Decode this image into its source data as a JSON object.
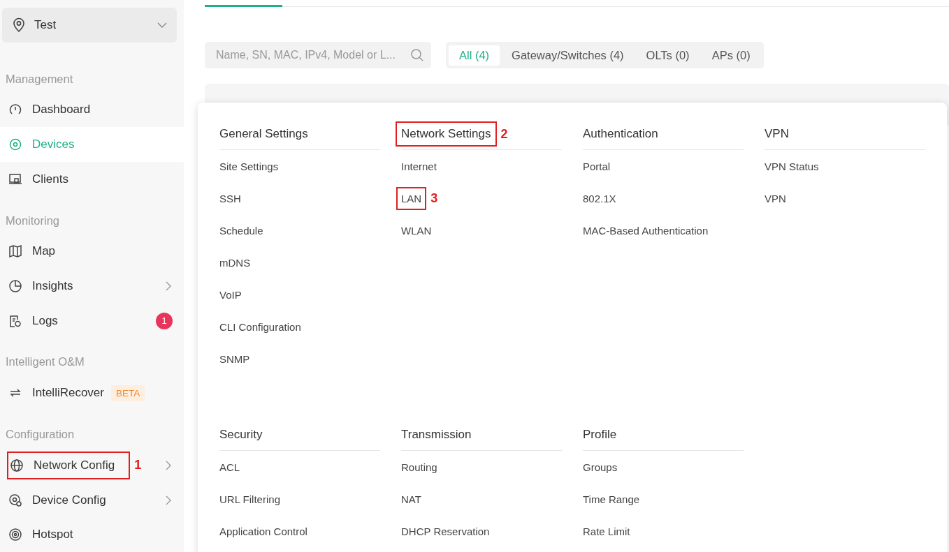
{
  "site_selector": {
    "value": "Test"
  },
  "sidebar": {
    "sections": [
      {
        "title": "Management",
        "items": [
          {
            "label": "Dashboard",
            "selected": false
          },
          {
            "label": "Devices",
            "selected": true
          },
          {
            "label": "Clients",
            "selected": false
          }
        ]
      },
      {
        "title": "Monitoring",
        "items": [
          {
            "label": "Map",
            "selected": false
          },
          {
            "label": "Insights",
            "selected": false,
            "expandable": true
          },
          {
            "label": "Logs",
            "selected": false,
            "badge": "1"
          }
        ]
      },
      {
        "title": "Intelligent O&M",
        "items": [
          {
            "label": "IntelliRecover",
            "selected": false,
            "tag": "BETA"
          }
        ]
      },
      {
        "title": "Configuration",
        "items": [
          {
            "label": "Network Config",
            "selected": false,
            "expandable": true,
            "annotation": "1"
          },
          {
            "label": "Device Config",
            "selected": false,
            "expandable": true
          },
          {
            "label": "Hotspot",
            "selected": false
          }
        ]
      }
    ]
  },
  "search": {
    "placeholder": "Name, SN, MAC, IPv4, Model or L..."
  },
  "filter_tabs": [
    {
      "label": "All (4)",
      "selected": true
    },
    {
      "label": "Gateway/Switches (4)",
      "selected": false
    },
    {
      "label": "OLTs (0)",
      "selected": false
    },
    {
      "label": "APs (0)",
      "selected": false
    }
  ],
  "table": {
    "header_visible": true
  },
  "menu": {
    "rows": [
      [
        {
          "title": "General Settings",
          "items": [
            {
              "label": "Site Settings"
            },
            {
              "label": "SSH"
            },
            {
              "label": "Schedule"
            },
            {
              "label": "mDNS"
            },
            {
              "label": "VoIP"
            },
            {
              "label": "CLI Configuration"
            },
            {
              "label": "SNMP"
            }
          ]
        },
        {
          "title": "Network Settings",
          "annotation": "2",
          "items": [
            {
              "label": "Internet"
            },
            {
              "label": "LAN",
              "annotation": "3"
            },
            {
              "label": "WLAN"
            }
          ]
        },
        {
          "title": "Authentication",
          "items": [
            {
              "label": "Portal"
            },
            {
              "label": "802.1X"
            },
            {
              "label": "MAC-Based Authentication"
            }
          ]
        },
        {
          "title": "VPN",
          "items": [
            {
              "label": "VPN Status"
            },
            {
              "label": "VPN"
            }
          ]
        }
      ],
      [
        {
          "title": "Security",
          "items": [
            {
              "label": "ACL"
            },
            {
              "label": "URL Filtering"
            },
            {
              "label": "Application Control"
            }
          ]
        },
        {
          "title": "Transmission",
          "items": [
            {
              "label": "Routing"
            },
            {
              "label": "NAT"
            },
            {
              "label": "DHCP Reservation"
            }
          ]
        },
        {
          "title": "Profile",
          "items": [
            {
              "label": "Groups"
            },
            {
              "label": "Time Range"
            },
            {
              "label": "Rate Limit"
            }
          ]
        }
      ]
    ]
  }
}
